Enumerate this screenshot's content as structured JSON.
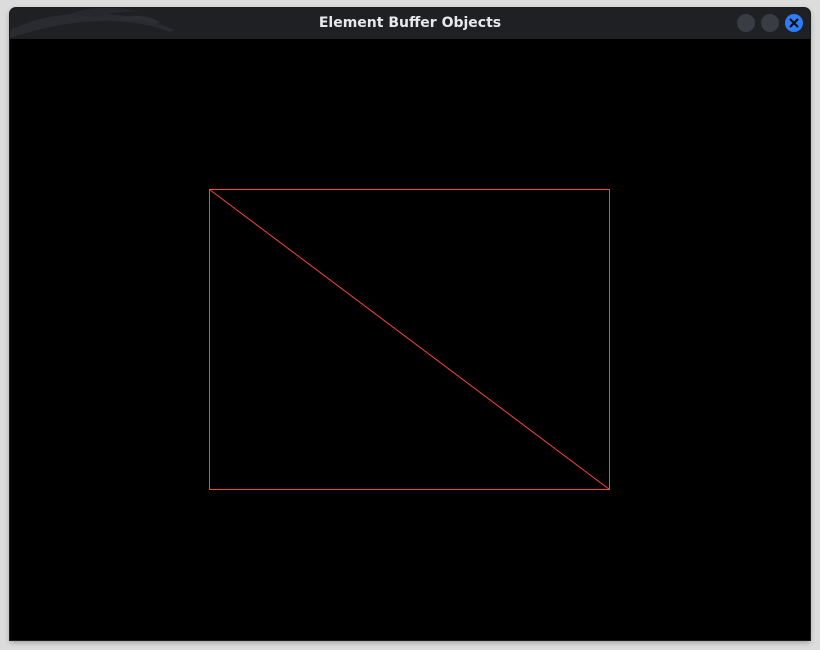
{
  "window": {
    "title": "Element Buffer Objects",
    "controls": {
      "minimize_icon": "minimize-icon",
      "maximize_icon": "maximize-icon",
      "close_icon": "close-icon"
    }
  },
  "render": {
    "mode": "wireframe",
    "background_color": "#000000",
    "line_color": "#ff4040",
    "close_button_color": "#2f7cf6"
  }
}
